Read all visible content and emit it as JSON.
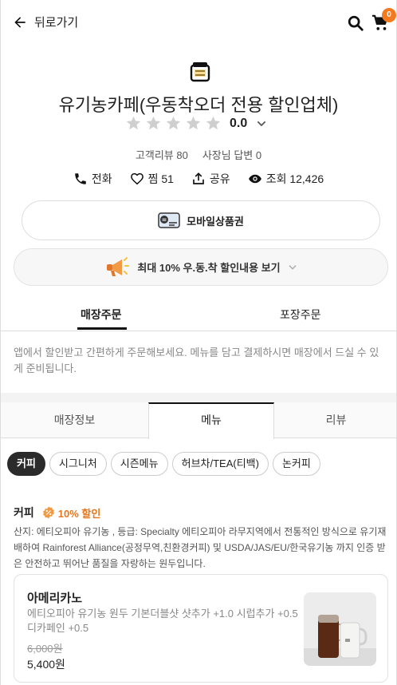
{
  "header": {
    "back_label": "뒤로가기",
    "cart_count": "0"
  },
  "store": {
    "name": "유기농카페(우동착오더 전용 할인업체)",
    "rating": "0.0",
    "review_count_label": "고객리뷰 80",
    "owner_reply_label": "사장님 답변 0"
  },
  "actions": {
    "call": "전화",
    "like": "찜 51",
    "share": "공유",
    "views": "조회 12,426"
  },
  "gift": {
    "label": "모바일상품권"
  },
  "discount_banner": {
    "label": "최대 10% 우.동.착 할인내용 보기"
  },
  "order_tabs": [
    {
      "label": "매장주문",
      "active": true
    },
    {
      "label": "포장주문",
      "active": false
    }
  ],
  "order_note": "앱에서 할인받고 간편하게 주문해보세요. 메뉴를 담고 결제하시면 매장에서 드실 수 있게 준비됩니다.",
  "main_tabs": [
    {
      "label": "매장정보",
      "active": false
    },
    {
      "label": "메뉴",
      "active": true
    },
    {
      "label": "리뷰",
      "active": false
    }
  ],
  "categories": [
    {
      "label": "커피",
      "active": true
    },
    {
      "label": "시그니처",
      "active": false
    },
    {
      "label": "시즌메뉴",
      "active": false
    },
    {
      "label": "허브차/TEA(티백)",
      "active": false
    },
    {
      "label": "논커피",
      "active": false
    }
  ],
  "section": {
    "title": "커피",
    "badge": "10% 할인",
    "description": "산지: 에티오피아 유기농 , 등급: Specialty 에티오피아 라무지역에서 전통적인 방식으로 유기재배하여 Rainforest Alliance(공정무역,친환경커피) 및 USDA/JAS/EU/한국유기농 까지 인증 받은 안전하고 뛰어난 품질을 자랑하는 원두입니다."
  },
  "item": {
    "name": "아메리카노",
    "options": "에티오피아 유기농 원두 기본더블샷 샷추가 +1.0 시럽추가 +0.5 디카페인 +0.5",
    "original_price": "6,000원",
    "price": "5,400원"
  },
  "colors": {
    "accent": "#f47a20",
    "discount_orange": "#e8761c",
    "star_empty": "#cfcfcf"
  }
}
